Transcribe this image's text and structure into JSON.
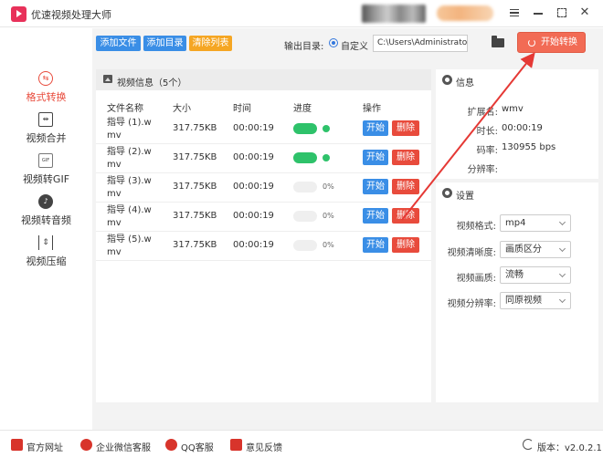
{
  "app": {
    "title": "优速视频处理大师"
  },
  "sidebar": {
    "items": [
      {
        "label": "格式转换",
        "icon": "format-convert-icon",
        "active": true
      },
      {
        "label": "视频合并",
        "icon": "video-merge-icon",
        "active": false
      },
      {
        "label": "视频转GIF",
        "icon": "gif-icon",
        "active": false
      },
      {
        "label": "视频转音频",
        "icon": "audio-icon",
        "active": false
      },
      {
        "label": "视频压缩",
        "icon": "compress-icon",
        "active": false
      }
    ]
  },
  "toolbar": {
    "add_file": "添加文件",
    "add_folder": "添加目录",
    "clear_list": "清除列表",
    "output_label": "输出目录:",
    "custom_label": "自定义",
    "output_path": "C:\\Users\\Administrator\\",
    "start_convert": "开始转换"
  },
  "file_list": {
    "title": "视频信息（5个）",
    "columns": [
      "文件名称",
      "大小",
      "时间",
      "进度",
      "操作"
    ],
    "rows": [
      {
        "name": "指导 (1).wmv",
        "size": "317.75KB",
        "time": "00:00:19",
        "progress": 100,
        "progress_text": ""
      },
      {
        "name": "指导 (2).wmv",
        "size": "317.75KB",
        "time": "00:00:19",
        "progress": 100,
        "progress_text": ""
      },
      {
        "name": "指导 (3).wmv",
        "size": "317.75KB",
        "time": "00:00:19",
        "progress": 0,
        "progress_text": "0%"
      },
      {
        "name": "指导 (4).wmv",
        "size": "317.75KB",
        "time": "00:00:19",
        "progress": 0,
        "progress_text": "0%"
      },
      {
        "name": "指导 (5).wmv",
        "size": "317.75KB",
        "time": "00:00:19",
        "progress": 0,
        "progress_text": "0%"
      }
    ],
    "start_label": "开始",
    "delete_label": "删除"
  },
  "info": {
    "title": "信息",
    "fields": [
      {
        "label": "扩展名:",
        "value": "wmv"
      },
      {
        "label": "时长:",
        "value": "00:00:19"
      },
      {
        "label": "码率:",
        "value": "130955 bps"
      },
      {
        "label": "分辨率:",
        "value": ""
      }
    ]
  },
  "settings": {
    "title": "设置",
    "fields": [
      {
        "label": "视频格式:",
        "value": "mp4"
      },
      {
        "label": "视频清晰度:",
        "value": "画质区分"
      },
      {
        "label": "视频画质:",
        "value": "流畅"
      },
      {
        "label": "视频分辨率:",
        "value": "同原视频"
      }
    ]
  },
  "footer": {
    "website": "官方网址",
    "wechat": "企业微信客服",
    "qq": "QQ客服",
    "feedback": "意见反馈",
    "version": "版本：v2.0.2.1"
  },
  "colors": {
    "accent_red": "#e84b3c",
    "start_convert_bg": "#f26b55",
    "button_blue": "#3a8ee6",
    "button_orange": "#f5a623",
    "progress_green": "#2ec26a"
  }
}
